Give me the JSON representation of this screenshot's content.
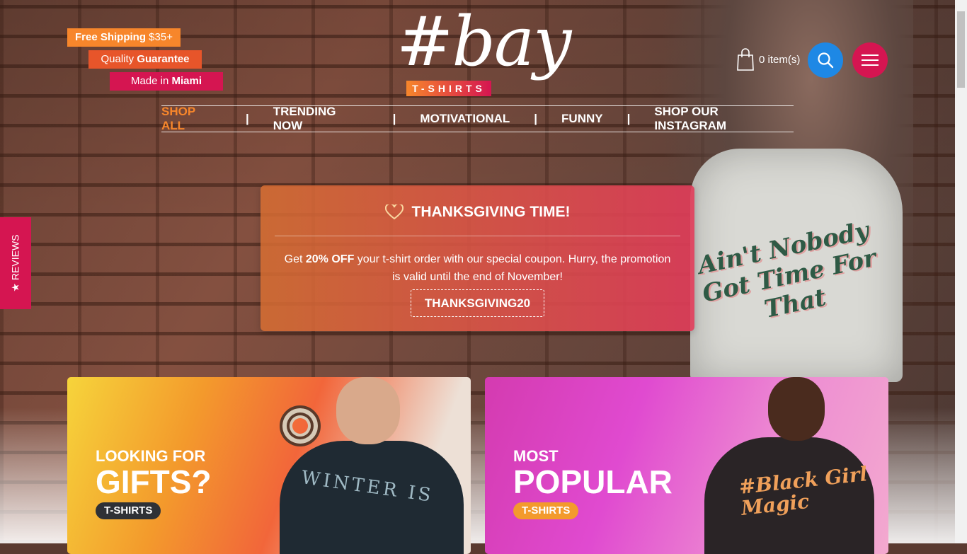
{
  "badges": {
    "shipping": {
      "bold": "Free Shipping",
      "rest": " $35+"
    },
    "quality": {
      "rest": "Quality ",
      "bold": "Guarantee"
    },
    "made": {
      "rest": "Made in ",
      "bold": "Miami"
    }
  },
  "logo": {
    "main": "#bay",
    "tag": "T-SHIRTS"
  },
  "cart": {
    "label": "0 item(s)"
  },
  "nav": {
    "items": [
      "SHOP ALL",
      "TRENDING NOW",
      "MOTIVATIONAL",
      "FUNNY",
      "SHOP OUR INSTAGRAM"
    ],
    "separator": "|"
  },
  "promo": {
    "title": "THANKSGIVING TIME!",
    "text_before": "Get ",
    "text_bold": "20% OFF",
    "text_after": " your t-shirt order with our special coupon. Hurry, the promotion is valid until the end of November!",
    "coupon": "THANKSGIVING20"
  },
  "reviews": {
    "label": "★ REVIEWS"
  },
  "hero_shirt": {
    "text": "Ain't Nobody Got Time For That"
  },
  "cards": [
    {
      "small": "LOOKING FOR",
      "big": "GIFTS?",
      "pill": "T-SHIRTS",
      "shirt_text": "WINTER IS"
    },
    {
      "small": "MOST",
      "big": "POPULAR",
      "pill": "T-SHIRTS",
      "shirt_text": "#Black Girl Magic"
    }
  ],
  "colors": {
    "orange": "#f7862b",
    "red_orange": "#e7552a",
    "pink": "#d51551",
    "blue": "#1e88e5"
  },
  "icons": {
    "cart": "shopping-bag-icon",
    "search": "search-icon",
    "menu": "hamburger-menu-icon",
    "promo": "heart-icon"
  }
}
